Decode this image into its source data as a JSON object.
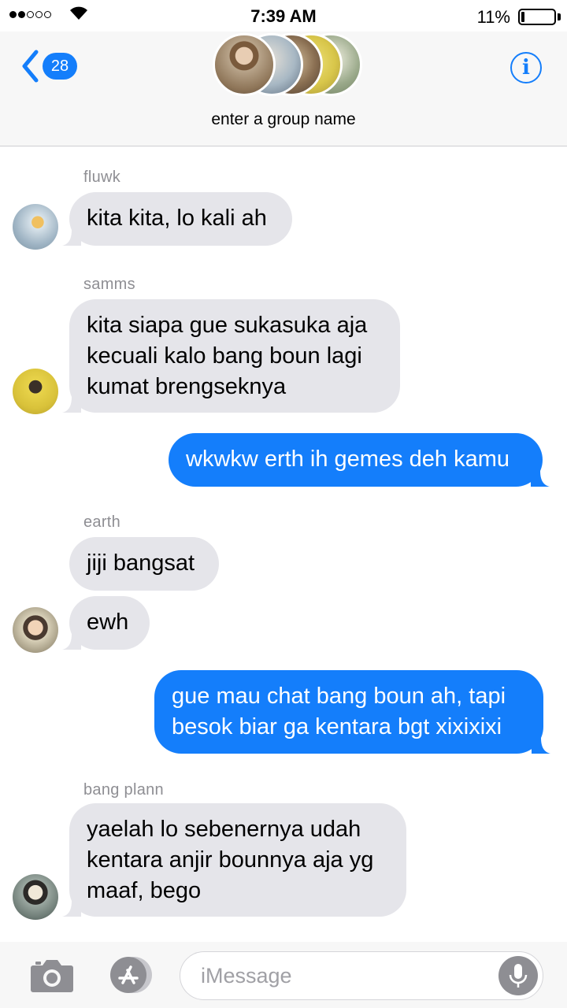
{
  "status_bar": {
    "time": "7:39 AM",
    "battery_percent": "11%",
    "battery_level": 0.11,
    "signal_bars_filled": 2,
    "signal_bars_total": 5
  },
  "header": {
    "back_count": "28",
    "group_name": "enter a group name",
    "back_icon": "chevron-left-icon",
    "info_icon": "info-icon",
    "info_glyph": "i"
  },
  "messages": [
    {
      "sender": "fluwk",
      "text": "kita kita, lo kali ah",
      "direction": "in"
    },
    {
      "sender": "samms",
      "text": "kita siapa gue sukasuka aja\nkecuali kalo bang boun lagi\nkumat brengseknya",
      "direction": "in"
    },
    {
      "sender": "",
      "text": "wkwkw erth ih gemes deh kamu",
      "direction": "out"
    },
    {
      "sender": "earth",
      "text": "jiji bangsat",
      "direction": "in"
    },
    {
      "sender": "",
      "text": "ewh",
      "direction": "in"
    },
    {
      "sender": "",
      "text": "gue mau chat bang boun ah, tapi\nbesok biar ga kentara bgt xixixixi",
      "direction": "out"
    },
    {
      "sender": "bang plann",
      "text": "yaelah lo sebenernya udah\nkentara anjir bounnya aja yg\nmaaf, bego",
      "direction": "in"
    }
  ],
  "input_bar": {
    "placeholder": "iMessage",
    "camera_icon": "camera-icon",
    "apps_icon": "app-store-icon",
    "mic_icon": "microphone-icon"
  },
  "colors": {
    "accent": "#147efb",
    "incoming_bubble": "#e5e5ea",
    "outgoing_bubble": "#147efb",
    "header_bg": "#f7f7f7",
    "sender_label": "#8e8e93"
  }
}
